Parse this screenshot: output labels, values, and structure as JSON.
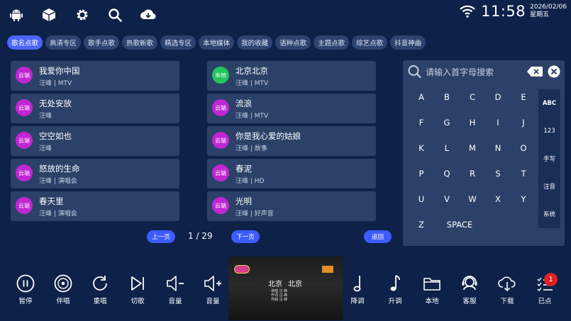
{
  "status": {
    "time": "11:58",
    "date": "2026/02/06",
    "weekday": "星期五"
  },
  "top_icons": [
    "android-icon",
    "box-icon",
    "gear-icon",
    "search-icon",
    "cloud-download-icon"
  ],
  "tabs": [
    "歌名点歌",
    "高清专区",
    "歌手点歌",
    "热歌新歌",
    "精选专区",
    "本地媒体",
    "我的收藏",
    "语种点歌",
    "主题点歌",
    "综艺点歌",
    "抖音神曲"
  ],
  "active_tab": 0,
  "songs": [
    {
      "title": "我爱你中国",
      "sub": "汪峰 | MTV",
      "badge": "云端"
    },
    {
      "title": "无处安放",
      "sub": "汪峰",
      "badge": "云端"
    },
    {
      "title": "空空如也",
      "sub": "汪峰",
      "badge": "云端"
    },
    {
      "title": "怒放的生命",
      "sub": "汪峰 | 演唱会",
      "badge": "云端"
    },
    {
      "title": "春天里",
      "sub": "汪峰 | 演唱会",
      "badge": "云端"
    },
    {
      "title": "北京北京",
      "sub": "汪峰 | MTV",
      "badge": "本地"
    },
    {
      "title": "流浪",
      "sub": "汪峰 | MTV",
      "badge": "云端"
    },
    {
      "title": "你是我心爱的姑娘",
      "sub": "汪峰 | 故事",
      "badge": "云端"
    },
    {
      "title": "春泥",
      "sub": "汪峰 | HD",
      "badge": "云端"
    },
    {
      "title": "光明",
      "sub": "汪峰 | 好声音",
      "badge": "云端"
    }
  ],
  "badge_colors": {
    "云端": "#c026d3",
    "本地": "#22c55e"
  },
  "pager": {
    "prev": "上一页",
    "page": "1 / 29",
    "next": "下一页",
    "back": "返回"
  },
  "keyboard": {
    "placeholder": "请输入首字母搜索",
    "keys": [
      "A",
      "B",
      "C",
      "D",
      "E",
      "F",
      "G",
      "H",
      "I",
      "J",
      "K",
      "L",
      "M",
      "N",
      "O",
      "P",
      "Q",
      "R",
      "S",
      "T",
      "U",
      "V",
      "W",
      "X",
      "Y",
      "Z"
    ],
    "space": "SPACE",
    "modes": [
      "ABC",
      "123",
      "手写",
      "注音",
      "系统"
    ],
    "active_mode": 0
  },
  "video": {
    "title_left": "北京",
    "title_right": "北京",
    "credit_lines": [
      "演唱 汪 峰",
      "作词 汪 峰",
      "作曲 汪 峰"
    ]
  },
  "controls_left": [
    {
      "label": "暂停",
      "icon": "pause-icon"
    },
    {
      "label": "伴唱",
      "icon": "disc-icon"
    },
    {
      "label": "重唱",
      "icon": "replay-icon"
    },
    {
      "label": "切歌",
      "icon": "skip-next-icon"
    },
    {
      "label": "音量",
      "icon": "volume-down-icon"
    },
    {
      "label": "音量",
      "icon": "volume-up-icon"
    }
  ],
  "controls_right": [
    {
      "label": "降调",
      "icon": "pitch-down-icon"
    },
    {
      "label": "升调",
      "icon": "pitch-up-icon"
    },
    {
      "label": "本地",
      "icon": "folder-icon"
    },
    {
      "label": "客服",
      "icon": "headset-icon"
    },
    {
      "label": "下载",
      "icon": "cloud-download-icon"
    },
    {
      "label": "已点",
      "icon": "playlist-icon"
    }
  ],
  "selected_count": "1",
  "accent": "#4a66ff"
}
